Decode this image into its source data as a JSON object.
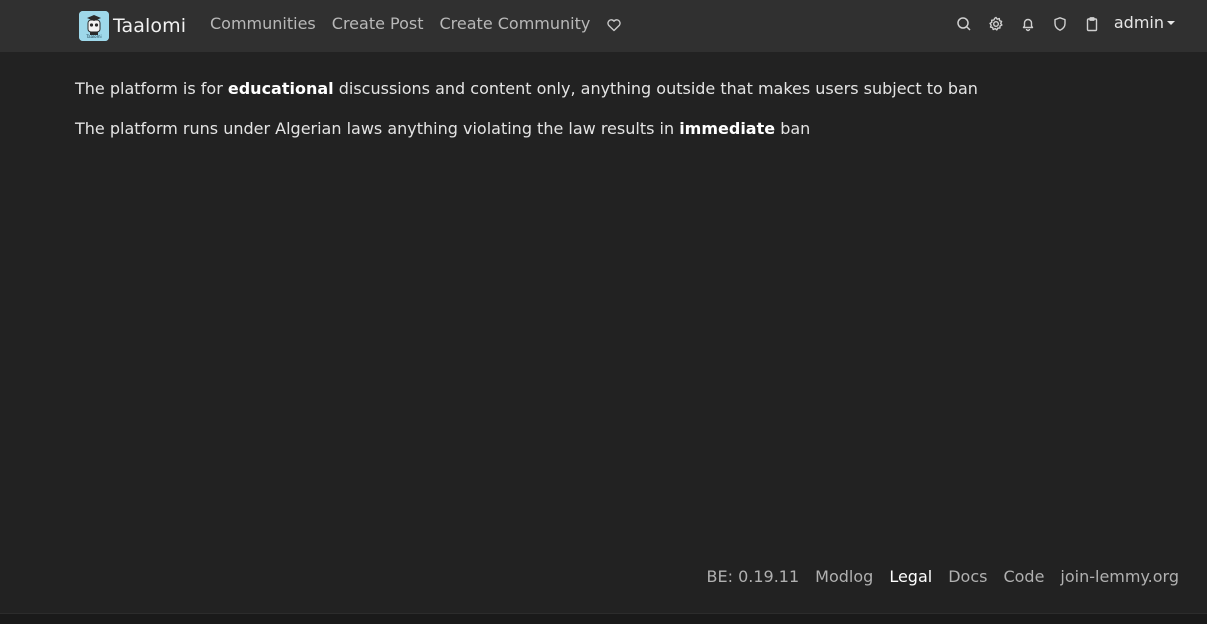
{
  "brand": {
    "name": "Taalomi",
    "logo_text": "Taalomi"
  },
  "nav": {
    "links": [
      "Communities",
      "Create Post",
      "Create Community"
    ],
    "donate_icon": "heart-icon",
    "icons": [
      "search-icon",
      "gear-icon",
      "bell-icon",
      "shield-icon",
      "clipboard-icon"
    ],
    "user": "admin"
  },
  "content": {
    "paragraphs": [
      {
        "before": "The platform is for ",
        "bold": "educational",
        "after": " discussions and content only, anything outside that makes users subject to ban"
      },
      {
        "before": "The platform runs under Algerian laws anything violating the law results in ",
        "bold": "immediate",
        "after": " ban"
      }
    ]
  },
  "footer": {
    "version": "BE: 0.19.11",
    "links": [
      "Modlog",
      "Legal",
      "Docs",
      "Code",
      "join-lemmy.org"
    ],
    "active": "Legal"
  },
  "colors": {
    "background": "#222222",
    "navbar": "#303030",
    "text": "#dee2e6",
    "muted": "#b0b0b0"
  }
}
